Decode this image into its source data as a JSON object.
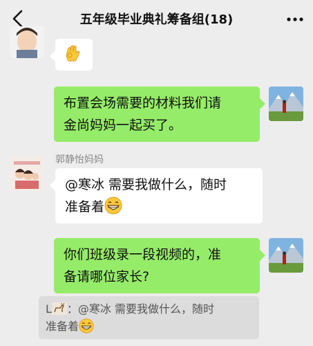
{
  "header": {
    "title": "五年级毕业典礼筹备组(18)",
    "back_icon": "chevron-left-icon",
    "more_icon": "more-dots-icon"
  },
  "messages": [
    {
      "side": "left",
      "avatar": "boy-avatar",
      "emoji": "ok-hand-emoji"
    },
    {
      "side": "right",
      "avatar": "mountain-avatar",
      "lines": [
        "布置会场需要的材料我们请",
        "金尚妈妈一起买了。"
      ]
    },
    {
      "side": "left",
      "sender": "郭静怡妈妈",
      "avatar": "family-avatar",
      "lines": [
        "@寒冰 需要我做什么，随时",
        "准备着"
      ],
      "trailing_emoji": "grin-emoji"
    },
    {
      "side": "right",
      "avatar": "mountain-avatar",
      "lines": [
        "你们班级录一段视频的，准",
        "备请哪位家长?"
      ]
    }
  ],
  "quote": {
    "prefix": "L",
    "lines": [
      "：@寒冰 需要我做什么，随时",
      "准备着"
    ],
    "trailing_emoji": "grin-emoji"
  },
  "colors": {
    "background": "#ededed",
    "green_bubble": "#95ec69",
    "white_bubble": "#ffffff",
    "quote_bg": "#dcdcdc"
  }
}
